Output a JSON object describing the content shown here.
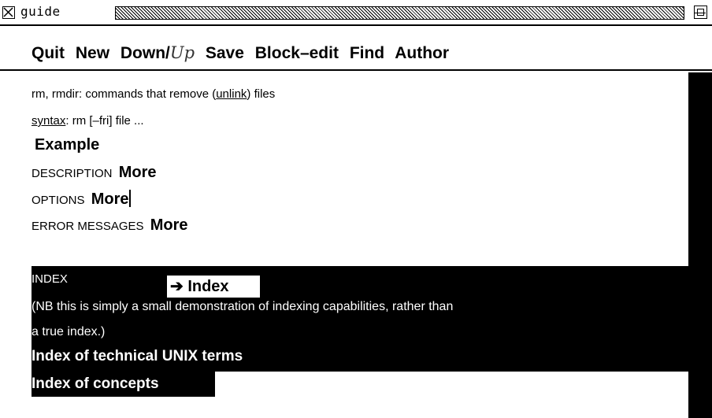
{
  "window": {
    "title": "guide"
  },
  "menu": {
    "quit": "Quit",
    "new": "New",
    "down": "Down/",
    "up": "Up",
    "save": "Save",
    "block_edit": "Block–edit",
    "find": "Find",
    "author": "Author"
  },
  "content": {
    "line1_prefix": "rm, rmdir: commands that remove (",
    "line1_link": "unlink",
    "line1_suffix": ") files",
    "syntax_label": "syntax",
    "syntax_rest": ":  rm [–fri] file ...",
    "example": "Example",
    "description_label": "DESCRIPTION",
    "description_more": "More",
    "options_label": "OPTIONS",
    "options_more": "More",
    "errors_label": "ERROR MESSAGES",
    "errors_more": "More",
    "index_label": "INDEX",
    "index_button": "➔ Index",
    "note_line1": "(NB this is simply a small demonstration of indexing capabilities, rather than",
    "note_line2": "a true index.)",
    "index_unix": "Index of technical UNIX terms",
    "index_concepts": "Index of concepts"
  }
}
